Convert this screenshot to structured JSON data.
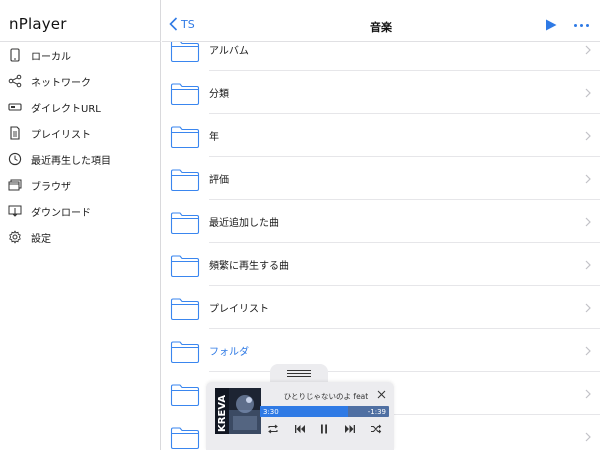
{
  "app": {
    "title": "nPlayer"
  },
  "sidebar": {
    "items": [
      {
        "label": "ローカル",
        "icon": "phone-icon"
      },
      {
        "label": "ネットワーク",
        "icon": "share-icon"
      },
      {
        "label": "ダイレクトURL",
        "icon": "drive-icon"
      },
      {
        "label": "プレイリスト",
        "icon": "document-icon"
      },
      {
        "label": "最近再生した項目",
        "icon": "clock-icon"
      },
      {
        "label": "ブラウザ",
        "icon": "browser-icon"
      },
      {
        "label": "ダウンロード",
        "icon": "download-icon"
      },
      {
        "label": "設定",
        "icon": "gear-icon"
      }
    ]
  },
  "nav": {
    "back_label": "TS",
    "title": "音楽"
  },
  "list": {
    "items": [
      {
        "name": "アルバム"
      },
      {
        "name": "分類"
      },
      {
        "name": "年"
      },
      {
        "name": "評価"
      },
      {
        "name": "最近追加した曲"
      },
      {
        "name": "頻繁に再生する曲"
      },
      {
        "name": "プレイリスト"
      },
      {
        "name": "フォルダ",
        "active": true
      },
      {
        "name": ""
      },
      {
        "name": ""
      }
    ]
  },
  "player": {
    "song_title": "ひとりじゃないのよ feat",
    "elapsed": "3:30",
    "remaining": "-1:39",
    "progress": 0.68,
    "cover_text": "KREVA"
  },
  "colors": {
    "accent": "#2f7ae5",
    "folder_stroke": "#3a86ef",
    "separator": "#e6e6e9"
  }
}
